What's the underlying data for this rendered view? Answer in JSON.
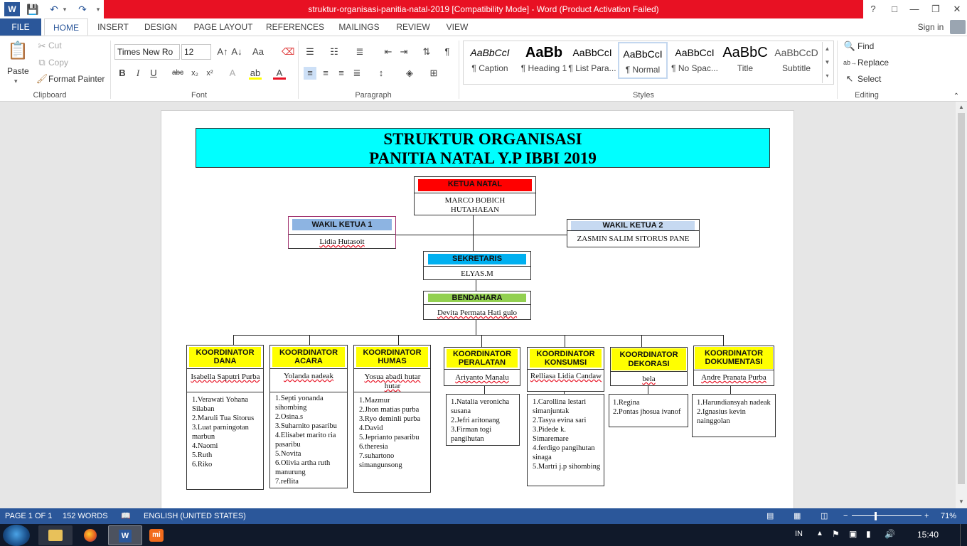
{
  "window": {
    "title": "struktur-organisasi-panitia-natal-2019 [Compatibility Mode] -  Word (Product Activation Failed)",
    "help": "?",
    "buttons": [
      "□",
      "—",
      "❐",
      "✕"
    ]
  },
  "tabs": [
    "FILE",
    "HOME",
    "INSERT",
    "DESIGN",
    "PAGE LAYOUT",
    "REFERENCES",
    "MAILINGS",
    "REVIEW",
    "VIEW"
  ],
  "signin": "Sign in",
  "ribbon": {
    "clipboard": {
      "paste": "Paste",
      "cut": "Cut",
      "copy": "Copy",
      "format_painter": "Format Painter",
      "label": "Clipboard"
    },
    "font": {
      "name": "Times New Ro",
      "size": "12",
      "label": "Font"
    },
    "paragraph": {
      "label": "Paragraph"
    },
    "styles": {
      "label": "Styles",
      "items": [
        {
          "preview": "AaBbCcI",
          "name": "¶ Caption"
        },
        {
          "preview": "AaBb",
          "name": "¶ Heading 1"
        },
        {
          "preview": "AaBbCcI",
          "name": "¶ List Para..."
        },
        {
          "preview": "AaBbCcI",
          "name": "¶ Normal"
        },
        {
          "preview": "AaBbCcI",
          "name": "¶ No Spac..."
        },
        {
          "preview": "AaBbC",
          "name": "Title"
        },
        {
          "preview": "AaBbCcD",
          "name": "Subtitle"
        }
      ]
    },
    "editing": {
      "find": "Find",
      "replace": "Replace",
      "select": "Select",
      "label": "Editing"
    }
  },
  "doc": {
    "title1": "STRUKTUR ORGANISASI",
    "title2": "PANITIA NATAL Y.P IBBI 2019",
    "ketua": {
      "header": "KETUA NATAL",
      "name1": "MARCO BOBICH",
      "name2": "HUTAHAEAN"
    },
    "wakil1": {
      "header": "WAKIL KETUA 1",
      "name": "Lidia Hutasoit"
    },
    "wakil2": {
      "header": "WAKIL KETUA 2",
      "name": "ZASMIN SALIM SITORUS PANE"
    },
    "sekretaris": {
      "header": "SEKRETARIS",
      "name": "ELYAS.M"
    },
    "bendahara": {
      "header": "BENDAHARA",
      "name": "Devita Permata Hati gulo"
    },
    "koordinators": [
      {
        "h1": "KOORDINATOR",
        "h2": "DANA",
        "name": "Isabella Saputri Purba",
        "members": [
          "1.Verawati Yohana Silaban",
          "2.Maruli Tua Sitorus",
          "3.Luat parningotan marbun",
          "4.Naomi",
          "5.Ruth",
          "6.Riko"
        ]
      },
      {
        "h1": "KOORDINATOR",
        "h2": "ACARA",
        "name": "Yolanda nadeak",
        "members": [
          "1.Septi yonanda sihombing",
          "2.Osina.s",
          "3.Suharnito pasaribu",
          "4.Elisabet marito ria pasaribu",
          "5.Novita",
          "6.Olivia artha ruth manurung",
          "7.reflita"
        ]
      },
      {
        "h1": "KOORDINATOR",
        "h2": "HUMAS",
        "name": "Yosua abadi hutar hutar",
        "members": [
          "1.Mazmur",
          "2.Jhon matias purba",
          "3.Ryo deminli purba",
          "4.David",
          "5.Jeprianto pasaribu",
          "6.theresia",
          "7.suhartono simangunsong"
        ]
      },
      {
        "h1": "KOORDINATOR",
        "h2": "PERALATAN",
        "name": "Ariyanto Manalu",
        "members": [
          "1.Natalia veronicha susana",
          "2.Jefri aritonang",
          "3.Firman togi pangihutan"
        ]
      },
      {
        "h1": "KOORDINATOR",
        "h2": "KONSUMSI",
        "name": "Relliasa Lidia Candaw",
        "members": [
          "1.Carollina lestari simanjuntak",
          "2.Tasya evina sari",
          "3.Pidede k. Simaremare",
          "4.ferdigo pangihutan sinaga",
          "5.Martri j.p sihombing"
        ]
      },
      {
        "h1": "KOORDINATOR",
        "h2": "DEKORASI",
        "name": "bela",
        "members": [
          "1.Regina",
          "2.Pontas jhosua ivanof"
        ]
      },
      {
        "h1": "KOORDINATOR",
        "h2": "DOKUMENTASI",
        "name": "Andre Pranata Purba",
        "members": [
          "1.Harundiansyah nadeak",
          "2.Ignasius kevin nainggolan"
        ]
      }
    ]
  },
  "status": {
    "page": "PAGE 1 OF 1",
    "words": "152 WORDS",
    "language": "ENGLISH (UNITED STATES)",
    "zoom": "71%"
  },
  "taskbar": {
    "lang": "IN",
    "time": "15:40"
  },
  "colors": {
    "accent": "#2b579a",
    "titlebar_red": "#e81123",
    "cyan": "#00ffff",
    "yellow": "#ffff00"
  }
}
